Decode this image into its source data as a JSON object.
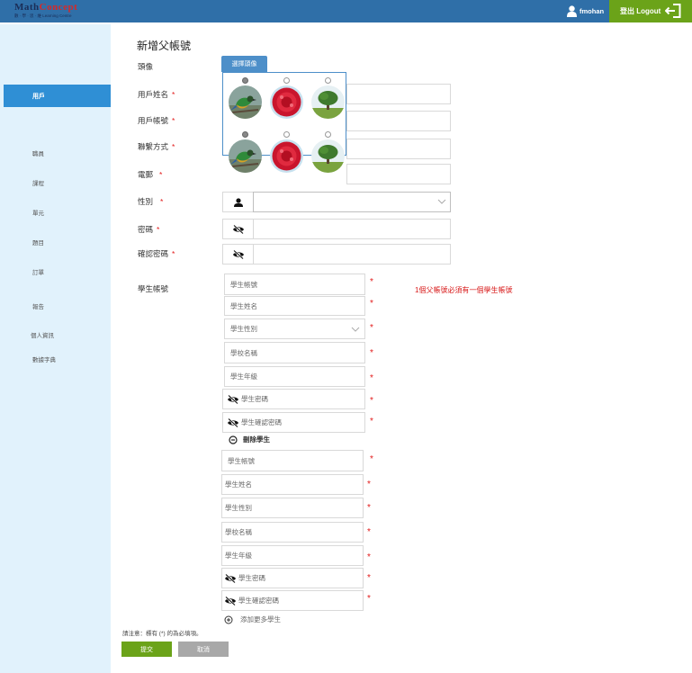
{
  "header": {
    "logo_brand_left": "Math",
    "logo_brand_right": "Concept",
    "logo_sub": "數 · 學 · 思 · 維  Learning Centre",
    "username": "fmohan",
    "logout_label": "登出 Logout"
  },
  "sidebar": {
    "active": "用戶",
    "items": [
      "職員",
      "課程",
      "單元",
      "題目",
      "訂單",
      "報告",
      "個人資訊",
      "數據字典"
    ]
  },
  "form": {
    "title": "新增父帳號",
    "avatar_label": "頭像",
    "choose_avatar_button": "選擇頭像",
    "avatar_options": [
      "bird",
      "flower",
      "tree",
      "bird",
      "flower",
      "tree"
    ],
    "labels": {
      "name": "用戶姓名",
      "account": "用戶帳號",
      "contact": "聯繫方式",
      "email": "電郵",
      "gender": "性別",
      "password": "密碼",
      "confirm_password": "確認密碼",
      "student_account": "學生帳號"
    },
    "required_mark": "*",
    "student_note": "1個父帳號必須有一個學生帳號",
    "student_placeholders": {
      "account": "學生帳號",
      "name": "學生姓名",
      "gender": "學生性別",
      "school": "學校名稱",
      "grade": "學生年級",
      "password": "學生密碼",
      "confirm_password": "學生確認密碼"
    },
    "delete_student": "刪除學生",
    "add_more_students": "添加更多學生",
    "footnote": "請注意：標有 (*) 的為必填項。",
    "submit": "提交",
    "cancel": "取消"
  },
  "colors": {
    "topbar": "#2f6fa8",
    "logout": "#6ba319",
    "sidebar": "#e1f2fc",
    "active_nav": "#2f8fd5",
    "required": "#e21b1b"
  }
}
